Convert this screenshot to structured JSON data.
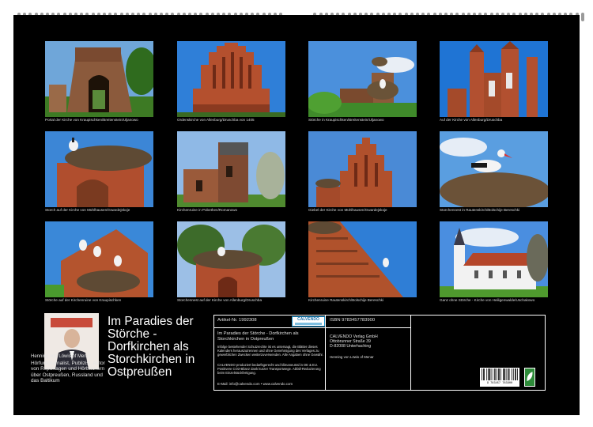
{
  "photos": [
    {
      "caption": "Portal der Kirche von Kraupischken/Breitenstein/Uljanowo",
      "icon": "church-portal-photo"
    },
    {
      "caption": "Ordenskirche von Allenburg/Druschba von 1405",
      "icon": "gable-church-photo"
    },
    {
      "caption": "Störche in Kraupischken/Breitenstein/Uljanowo",
      "icon": "stork-nest-photo"
    },
    {
      "caption": "Auf der Kirche von Allenburg/Druschba",
      "icon": "church-tower-photo"
    },
    {
      "caption": "Storch auf der Kirche von Mühlhausen/Gwardejskoje",
      "icon": "stork-nest-photo"
    },
    {
      "caption": "Kirchenruine in Pobethen/Romanowo",
      "icon": "church-ruin-photo"
    },
    {
      "caption": "Giebel der Kirche von Mühlhausen/Gwardejskoje",
      "icon": "gable-church-photo"
    },
    {
      "caption": "Storchennest in Rautenskirch/Bolschije Bereschki",
      "icon": "stork-nest-photo"
    },
    {
      "caption": "Störche auf der Kirchenruine von Kraupischken",
      "icon": "stork-nest-photo"
    },
    {
      "caption": "Storchennest auf der Kirche von Allenburg/Druschba",
      "icon": "stork-nest-photo"
    },
    {
      "caption": "Kirchenruine Rautenskirch/Bolschije Bereschki",
      "icon": "church-ruin-photo"
    },
    {
      "caption": "Ganz ohne Störche - Kirche von Heiligenwalde/Uschakowo",
      "icon": "white-church-photo"
    }
  ],
  "author": {
    "name": "Henning von Löwis of Menar",
    "bio": "Hörfunkjournalist, Publizist, Autor von Reportagen und Hörbüchern über Ostpreußen, Russland und das Baltikum"
  },
  "title": "Im Paradies der Störche - Dorfkirchen als Storchkirchen in Ostpreußen",
  "info": {
    "article_nr": "Artikel-Nr. 1992308",
    "logo": "CALVENDO",
    "title_small": "Im Paradies der Störche - Dorfkirchen als Storchkirchen in Ostpreußen",
    "legal": "Infolge bestehender Schutzrechte ist es untersagt, die Blätter dieses Kalenders herauszutrennen und ohne Genehmigung des Verlages zu gewerblichen Zwecken weiterzuverwenden. Alle Angaben ohne Gewähr.",
    "climate": "CALVENDO produziert bedarfsgerecht und klimaneutral in DE & EU. Positivere CO2-Bilanz dank kurzer Transportwege. Abfall-Reduzierung beim Einzelstückfertigung.",
    "contact": "E-Mail: info@calvendo.com • www.calvendo.com",
    "isbn": "ISBN 9783457783900",
    "publisher_name": "CALVENDO Verlag GmbH",
    "publisher_street": "Ottobrunner Straße 39",
    "publisher_city": "D-82008 Unterhaching",
    "author_credit": "Henning von Löwis of Menar",
    "barcode_number": "9 783457 783900"
  },
  "colors": {
    "sheet": "#000000",
    "accent": "#1a8fc9",
    "eco": "#2e8b3a"
  }
}
